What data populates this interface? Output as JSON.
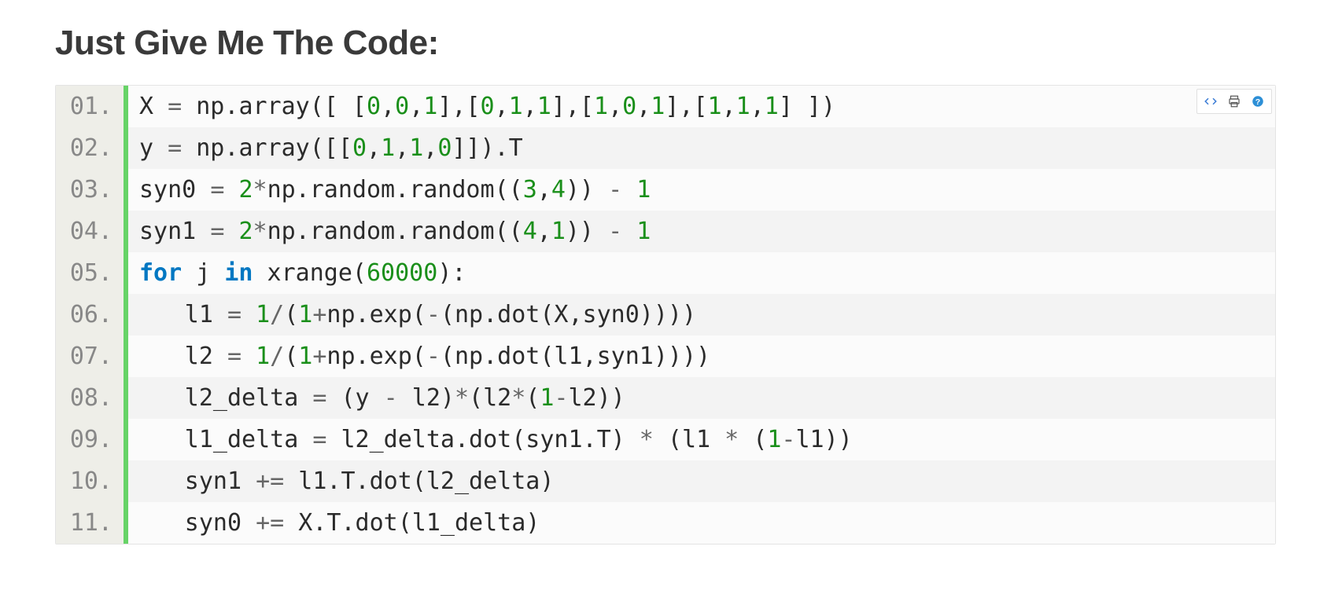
{
  "heading": "Just Give Me The Code:",
  "toolbar": {
    "view_source_title": "view source",
    "print_title": "print",
    "help_title": "help"
  },
  "code": {
    "lines": [
      {
        "n": "01.",
        "tokens": [
          {
            "t": "X ",
            "c": "id"
          },
          {
            "t": "=",
            "c": "op"
          },
          {
            "t": " np",
            "c": "id"
          },
          {
            "t": ".",
            "c": "punc"
          },
          {
            "t": "array",
            "c": "id"
          },
          {
            "t": "([ [",
            "c": "punc"
          },
          {
            "t": "0",
            "c": "num"
          },
          {
            "t": ",",
            "c": "punc"
          },
          {
            "t": "0",
            "c": "num"
          },
          {
            "t": ",",
            "c": "punc"
          },
          {
            "t": "1",
            "c": "num"
          },
          {
            "t": "],[",
            "c": "punc"
          },
          {
            "t": "0",
            "c": "num"
          },
          {
            "t": ",",
            "c": "punc"
          },
          {
            "t": "1",
            "c": "num"
          },
          {
            "t": ",",
            "c": "punc"
          },
          {
            "t": "1",
            "c": "num"
          },
          {
            "t": "],[",
            "c": "punc"
          },
          {
            "t": "1",
            "c": "num"
          },
          {
            "t": ",",
            "c": "punc"
          },
          {
            "t": "0",
            "c": "num"
          },
          {
            "t": ",",
            "c": "punc"
          },
          {
            "t": "1",
            "c": "num"
          },
          {
            "t": "],[",
            "c": "punc"
          },
          {
            "t": "1",
            "c": "num"
          },
          {
            "t": ",",
            "c": "punc"
          },
          {
            "t": "1",
            "c": "num"
          },
          {
            "t": ",",
            "c": "punc"
          },
          {
            "t": "1",
            "c": "num"
          },
          {
            "t": "] ])",
            "c": "punc"
          }
        ]
      },
      {
        "n": "02.",
        "tokens": [
          {
            "t": "y ",
            "c": "id"
          },
          {
            "t": "=",
            "c": "op"
          },
          {
            "t": " np",
            "c": "id"
          },
          {
            "t": ".",
            "c": "punc"
          },
          {
            "t": "array",
            "c": "id"
          },
          {
            "t": "([[",
            "c": "punc"
          },
          {
            "t": "0",
            "c": "num"
          },
          {
            "t": ",",
            "c": "punc"
          },
          {
            "t": "1",
            "c": "num"
          },
          {
            "t": ",",
            "c": "punc"
          },
          {
            "t": "1",
            "c": "num"
          },
          {
            "t": ",",
            "c": "punc"
          },
          {
            "t": "0",
            "c": "num"
          },
          {
            "t": "]]).",
            "c": "punc"
          },
          {
            "t": "T",
            "c": "id"
          }
        ]
      },
      {
        "n": "03.",
        "tokens": [
          {
            "t": "syn0 ",
            "c": "id"
          },
          {
            "t": "=",
            "c": "op"
          },
          {
            "t": " ",
            "c": "id"
          },
          {
            "t": "2",
            "c": "num"
          },
          {
            "t": "*",
            "c": "op"
          },
          {
            "t": "np",
            "c": "id"
          },
          {
            "t": ".",
            "c": "punc"
          },
          {
            "t": "random",
            "c": "id"
          },
          {
            "t": ".",
            "c": "punc"
          },
          {
            "t": "random",
            "c": "id"
          },
          {
            "t": "((",
            "c": "punc"
          },
          {
            "t": "3",
            "c": "num"
          },
          {
            "t": ",",
            "c": "punc"
          },
          {
            "t": "4",
            "c": "num"
          },
          {
            "t": ")) ",
            "c": "punc"
          },
          {
            "t": "-",
            "c": "op"
          },
          {
            "t": " ",
            "c": "id"
          },
          {
            "t": "1",
            "c": "num"
          }
        ]
      },
      {
        "n": "04.",
        "tokens": [
          {
            "t": "syn1 ",
            "c": "id"
          },
          {
            "t": "=",
            "c": "op"
          },
          {
            "t": " ",
            "c": "id"
          },
          {
            "t": "2",
            "c": "num"
          },
          {
            "t": "*",
            "c": "op"
          },
          {
            "t": "np",
            "c": "id"
          },
          {
            "t": ".",
            "c": "punc"
          },
          {
            "t": "random",
            "c": "id"
          },
          {
            "t": ".",
            "c": "punc"
          },
          {
            "t": "random",
            "c": "id"
          },
          {
            "t": "((",
            "c": "punc"
          },
          {
            "t": "4",
            "c": "num"
          },
          {
            "t": ",",
            "c": "punc"
          },
          {
            "t": "1",
            "c": "num"
          },
          {
            "t": ")) ",
            "c": "punc"
          },
          {
            "t": "-",
            "c": "op"
          },
          {
            "t": " ",
            "c": "id"
          },
          {
            "t": "1",
            "c": "num"
          }
        ]
      },
      {
        "n": "05.",
        "tokens": [
          {
            "t": "for",
            "c": "kw"
          },
          {
            "t": " j ",
            "c": "id"
          },
          {
            "t": "in",
            "c": "kw"
          },
          {
            "t": " xrange(",
            "c": "id"
          },
          {
            "t": "60000",
            "c": "num"
          },
          {
            "t": "):",
            "c": "punc"
          }
        ]
      },
      {
        "n": "06.",
        "indent": 1,
        "tokens": [
          {
            "t": "l1 ",
            "c": "id"
          },
          {
            "t": "=",
            "c": "op"
          },
          {
            "t": " ",
            "c": "id"
          },
          {
            "t": "1",
            "c": "num"
          },
          {
            "t": "/",
            "c": "op"
          },
          {
            "t": "(",
            "c": "punc"
          },
          {
            "t": "1",
            "c": "num"
          },
          {
            "t": "+",
            "c": "op"
          },
          {
            "t": "np",
            "c": "id"
          },
          {
            "t": ".",
            "c": "punc"
          },
          {
            "t": "exp",
            "c": "id"
          },
          {
            "t": "(",
            "c": "punc"
          },
          {
            "t": "-",
            "c": "op"
          },
          {
            "t": "(np",
            "c": "id"
          },
          {
            "t": ".",
            "c": "punc"
          },
          {
            "t": "dot",
            "c": "id"
          },
          {
            "t": "(X,syn0))))",
            "c": "punc"
          }
        ]
      },
      {
        "n": "07.",
        "indent": 1,
        "tokens": [
          {
            "t": "l2 ",
            "c": "id"
          },
          {
            "t": "=",
            "c": "op"
          },
          {
            "t": " ",
            "c": "id"
          },
          {
            "t": "1",
            "c": "num"
          },
          {
            "t": "/",
            "c": "op"
          },
          {
            "t": "(",
            "c": "punc"
          },
          {
            "t": "1",
            "c": "num"
          },
          {
            "t": "+",
            "c": "op"
          },
          {
            "t": "np",
            "c": "id"
          },
          {
            "t": ".",
            "c": "punc"
          },
          {
            "t": "exp",
            "c": "id"
          },
          {
            "t": "(",
            "c": "punc"
          },
          {
            "t": "-",
            "c": "op"
          },
          {
            "t": "(np",
            "c": "id"
          },
          {
            "t": ".",
            "c": "punc"
          },
          {
            "t": "dot",
            "c": "id"
          },
          {
            "t": "(l1,syn1))))",
            "c": "punc"
          }
        ]
      },
      {
        "n": "08.",
        "indent": 1,
        "tokens": [
          {
            "t": "l2_delta ",
            "c": "id"
          },
          {
            "t": "=",
            "c": "op"
          },
          {
            "t": " (y ",
            "c": "id"
          },
          {
            "t": "-",
            "c": "op"
          },
          {
            "t": " l2)",
            "c": "id"
          },
          {
            "t": "*",
            "c": "op"
          },
          {
            "t": "(l2",
            "c": "id"
          },
          {
            "t": "*",
            "c": "op"
          },
          {
            "t": "(",
            "c": "punc"
          },
          {
            "t": "1",
            "c": "num"
          },
          {
            "t": "-",
            "c": "op"
          },
          {
            "t": "l2))",
            "c": "id"
          }
        ]
      },
      {
        "n": "09.",
        "indent": 1,
        "tokens": [
          {
            "t": "l1_delta ",
            "c": "id"
          },
          {
            "t": "=",
            "c": "op"
          },
          {
            "t": " l2_delta",
            "c": "id"
          },
          {
            "t": ".",
            "c": "punc"
          },
          {
            "t": "dot",
            "c": "id"
          },
          {
            "t": "(syn1",
            "c": "id"
          },
          {
            "t": ".",
            "c": "punc"
          },
          {
            "t": "T) ",
            "c": "id"
          },
          {
            "t": "*",
            "c": "op"
          },
          {
            "t": " (l1 ",
            "c": "id"
          },
          {
            "t": "*",
            "c": "op"
          },
          {
            "t": " (",
            "c": "id"
          },
          {
            "t": "1",
            "c": "num"
          },
          {
            "t": "-",
            "c": "op"
          },
          {
            "t": "l1))",
            "c": "id"
          }
        ]
      },
      {
        "n": "10.",
        "indent": 1,
        "tokens": [
          {
            "t": "syn1 ",
            "c": "id"
          },
          {
            "t": "+",
            "c": "op"
          },
          {
            "t": "=",
            "c": "op"
          },
          {
            "t": " l1",
            "c": "id"
          },
          {
            "t": ".",
            "c": "punc"
          },
          {
            "t": "T",
            "c": "id"
          },
          {
            "t": ".",
            "c": "punc"
          },
          {
            "t": "dot",
            "c": "id"
          },
          {
            "t": "(l2_delta)",
            "c": "punc"
          }
        ]
      },
      {
        "n": "11.",
        "indent": 1,
        "tokens": [
          {
            "t": "syn0 ",
            "c": "id"
          },
          {
            "t": "+",
            "c": "op"
          },
          {
            "t": "=",
            "c": "op"
          },
          {
            "t": " X",
            "c": "id"
          },
          {
            "t": ".",
            "c": "punc"
          },
          {
            "t": "T",
            "c": "id"
          },
          {
            "t": ".",
            "c": "punc"
          },
          {
            "t": "dot",
            "c": "id"
          },
          {
            "t": "(l1_delta)",
            "c": "punc"
          }
        ]
      }
    ]
  }
}
